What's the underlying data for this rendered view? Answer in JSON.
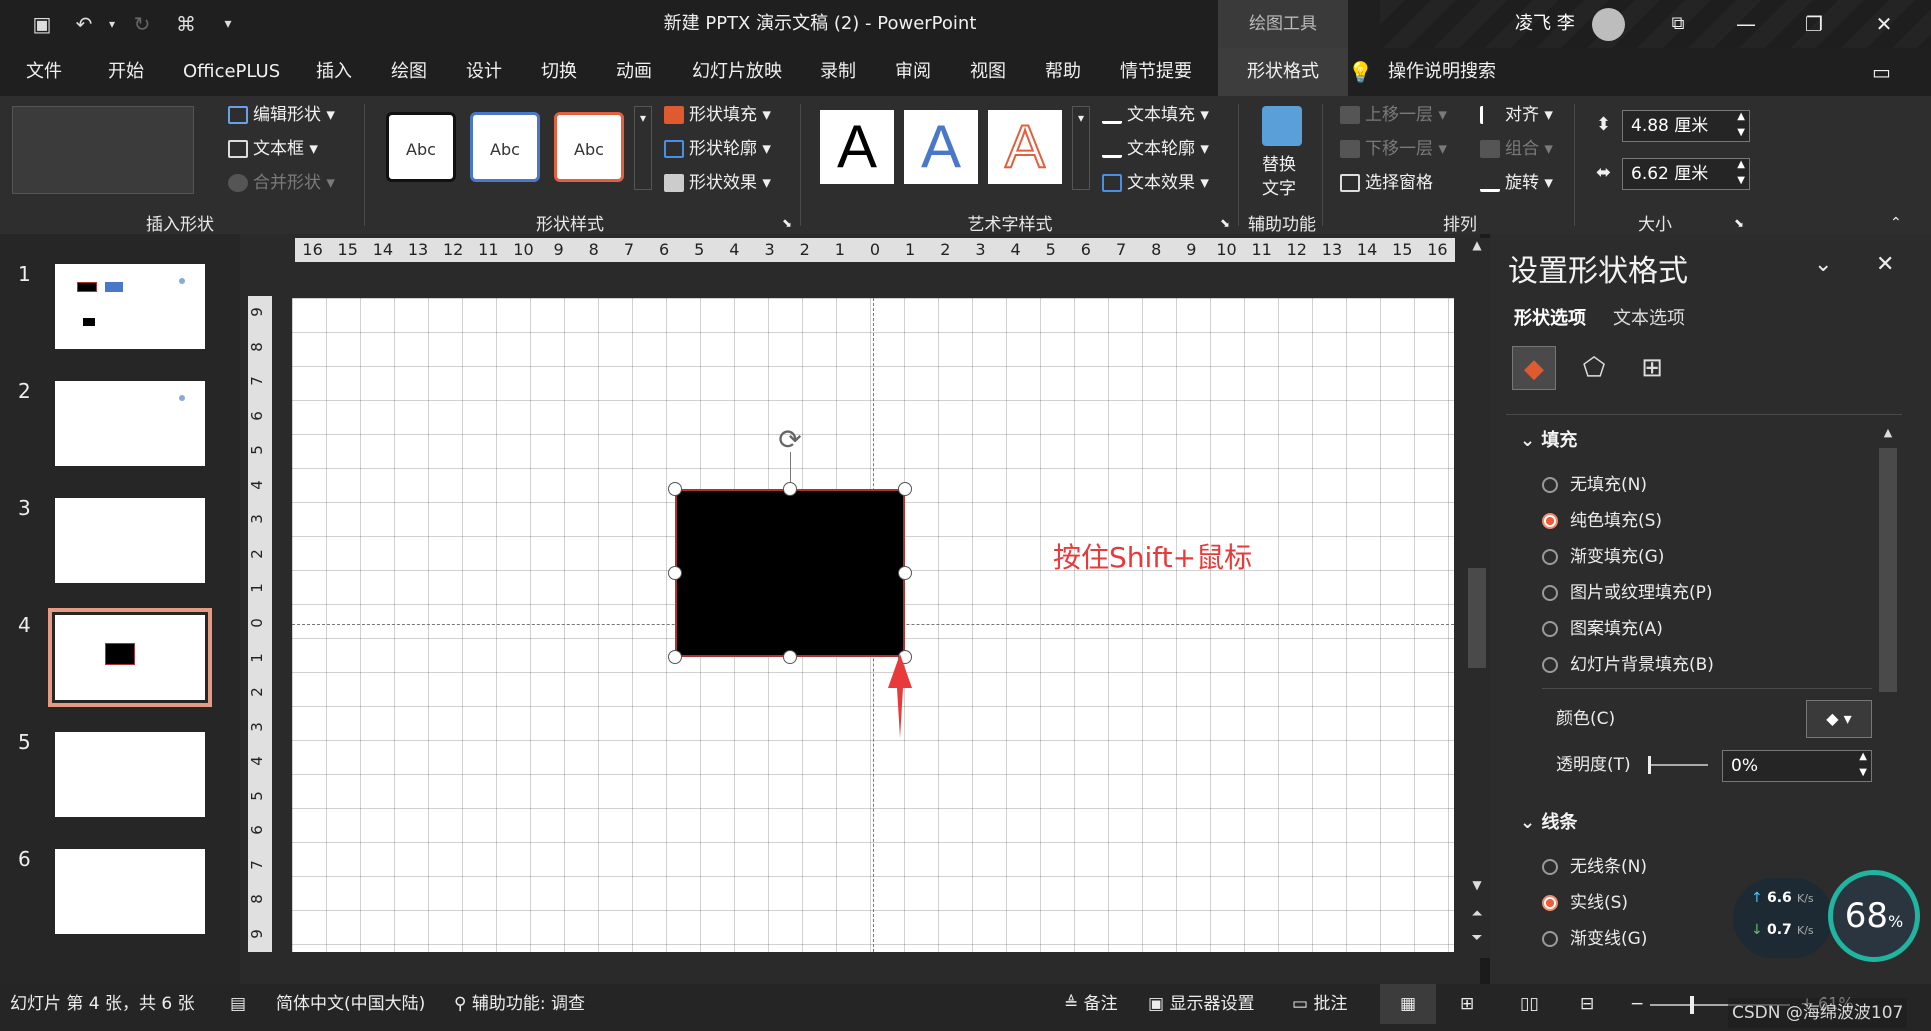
{
  "titlebar": {
    "title": "新建 PPTX 演示文稿 (2)  -  PowerPoint",
    "context_tab": "绘图工具",
    "user_name": "凌飞 李"
  },
  "menu": [
    "文件",
    "开始",
    "OfficePLUS",
    "插入",
    "绘图",
    "设计",
    "切换",
    "动画",
    "幻灯片放映",
    "录制",
    "审阅",
    "视图",
    "帮助",
    "情节提要",
    "形状格式"
  ],
  "menu_search": "操作说明搜索",
  "ribbon": {
    "insert_shapes": {
      "edit_shape": "编辑形状",
      "text_box": "文本框",
      "merge_shapes": "合并形状",
      "label": "插入形状"
    },
    "shape_styles": {
      "abc": "Abc",
      "fill": "形状填充",
      "outline": "形状轮廓",
      "effect": "形状效果",
      "label": "形状样式"
    },
    "wordart": {
      "glyph": "A",
      "text_fill": "文本填充",
      "text_outline": "文本轮廓",
      "text_effect": "文本效果",
      "label": "艺术字样式"
    },
    "accessibility": {
      "alt_text_1": "替换",
      "alt_text_2": "文字",
      "label": "辅助功能"
    },
    "arrange": {
      "bring_forward": "上移一层",
      "send_backward": "下移一层",
      "selection_pane": "选择窗格",
      "align": "对齐",
      "group": "组合",
      "rotate": "旋转",
      "label": "排列"
    },
    "size": {
      "height": "4.88 厘米",
      "width": "6.62 厘米",
      "label": "大小"
    }
  },
  "hruler_ticks": [
    "16",
    "15",
    "14",
    "13",
    "12",
    "11",
    "10",
    "9",
    "8",
    "7",
    "6",
    "5",
    "4",
    "3",
    "2",
    "1",
    "0",
    "1",
    "2",
    "3",
    "4",
    "5",
    "6",
    "7",
    "8",
    "9",
    "10",
    "11",
    "12",
    "13",
    "14",
    "15",
    "16"
  ],
  "vruler_ticks": [
    "9",
    "8",
    "7",
    "6",
    "5",
    "4",
    "3",
    "2",
    "1",
    "0",
    "1",
    "2",
    "3",
    "4",
    "5",
    "6",
    "7",
    "8",
    "9"
  ],
  "thumbnails": [
    {
      "num": "1"
    },
    {
      "num": "2"
    },
    {
      "num": "3"
    },
    {
      "num": "4"
    },
    {
      "num": "5"
    },
    {
      "num": "6"
    }
  ],
  "annotation": "按住Shift+鼠标",
  "pane": {
    "title": "设置形状格式",
    "tab_shape": "形状选项",
    "tab_text": "文本选项",
    "fill_section": "填充",
    "fill_options": [
      "无填充(N)",
      "纯色填充(S)",
      "渐变填充(G)",
      "图片或纹理填充(P)",
      "图案填充(A)",
      "幻灯片背景填充(B)"
    ],
    "color_label": "颜色(C)",
    "transparency_label": "透明度(T)",
    "transparency_value": "0%",
    "line_section": "线条",
    "line_options": [
      "无线条(N)",
      "实线(S)",
      "渐变线(G)"
    ]
  },
  "status": {
    "slide_info": "幻灯片 第 4 张，共 6 张",
    "language": "简体中文(中国大陆)",
    "accessibility": "辅助功能: 调查",
    "notes": "备注",
    "display": "显示器设置",
    "comments": "批注",
    "zoom": "61%"
  },
  "widget": {
    "up": "6.6",
    "down": "0.7",
    "unit": "K/s",
    "cpu": "68",
    "pct": "%"
  },
  "watermark": "CSDN @海绵波波107",
  "colors": {
    "accent": "#f05a3a",
    "slide_bg": "#ffffff",
    "shape_fill": "#000000",
    "annotation": "#e83a3a"
  }
}
